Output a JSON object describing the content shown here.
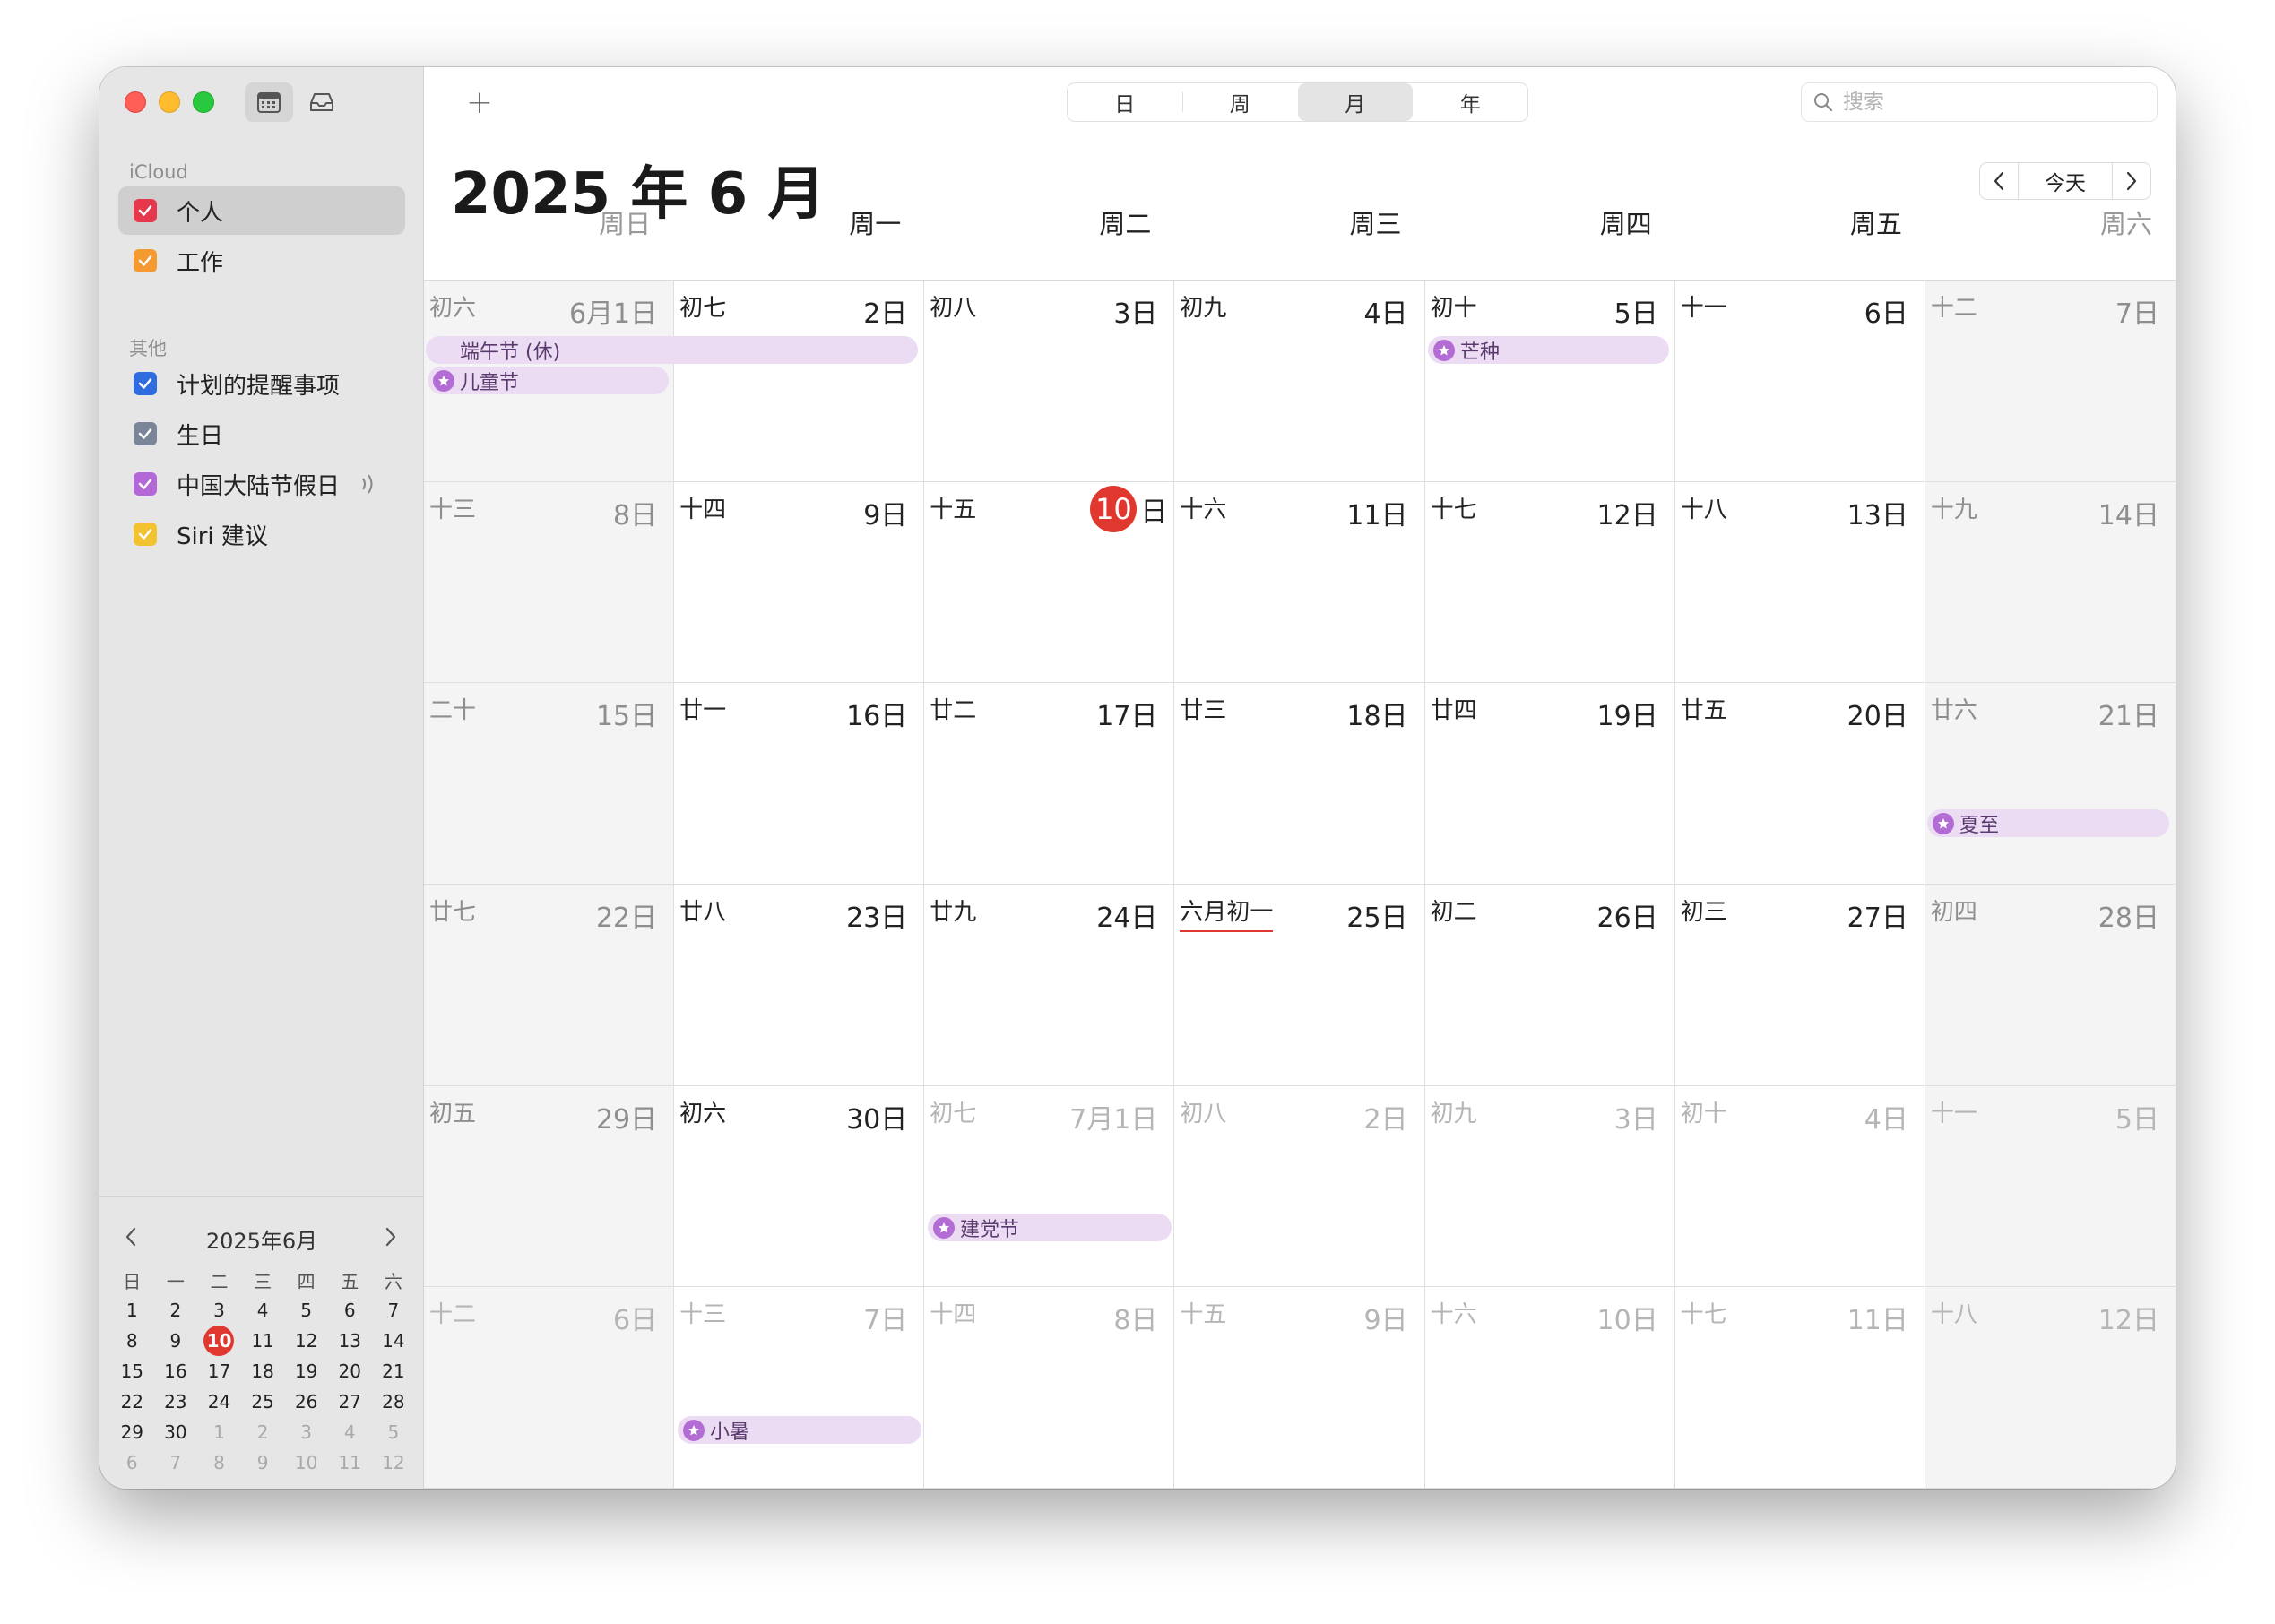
{
  "toolbar": {
    "views": [
      "日",
      "周",
      "月",
      "年"
    ],
    "active_view": "月",
    "search_placeholder": "搜索",
    "add_label": "+"
  },
  "sidebar": {
    "section_icloud": "iCloud",
    "icloud_items": [
      {
        "label": "个人",
        "color": "#e5384d",
        "selected": true
      },
      {
        "label": "工作",
        "color": "#f49a31",
        "selected": false
      }
    ],
    "section_other": "其他",
    "other_items": [
      {
        "label": "计划的提醒事项",
        "color": "#2f6ce0"
      },
      {
        "label": "生日",
        "color": "#7a8599"
      },
      {
        "label": "中国大陆节假日",
        "color": "#b467d6",
        "broadcast": true
      },
      {
        "label": "Siri 建议",
        "color": "#f3c230"
      }
    ]
  },
  "mini_calendar": {
    "title": "2025年6月",
    "weekdays": [
      "日",
      "一",
      "二",
      "三",
      "四",
      "五",
      "六"
    ],
    "rows": [
      [
        "1",
        "2",
        "3",
        "4",
        "5",
        "6",
        "7"
      ],
      [
        "8",
        "9",
        "10",
        "11",
        "12",
        "13",
        "14"
      ],
      [
        "15",
        "16",
        "17",
        "18",
        "19",
        "20",
        "21"
      ],
      [
        "22",
        "23",
        "24",
        "25",
        "26",
        "27",
        "28"
      ],
      [
        "29",
        "30",
        "1",
        "2",
        "3",
        "4",
        "5"
      ],
      [
        "6",
        "7",
        "8",
        "9",
        "10",
        "11",
        "12"
      ]
    ],
    "today": "10"
  },
  "header": {
    "month_title": "2025 年 6 月",
    "today_button": "今天"
  },
  "weekdays": [
    "周日",
    "周一",
    "周二",
    "周三",
    "周四",
    "周五",
    "周六"
  ],
  "weeks": [
    [
      {
        "lunar": "初六",
        "day": "6月1日"
      },
      {
        "lunar": "初七",
        "day": "2日"
      },
      {
        "lunar": "初八",
        "day": "3日"
      },
      {
        "lunar": "初九",
        "day": "4日"
      },
      {
        "lunar": "初十",
        "day": "5日"
      },
      {
        "lunar": "十一",
        "day": "6日"
      },
      {
        "lunar": "十二",
        "day": "7日"
      }
    ],
    [
      {
        "lunar": "十三",
        "day": "8日"
      },
      {
        "lunar": "十四",
        "day": "9日"
      },
      {
        "lunar": "十五",
        "day": "10",
        "day_suffix": "日"
      },
      {
        "lunar": "十六",
        "day": "11日"
      },
      {
        "lunar": "十七",
        "day": "12日"
      },
      {
        "lunar": "十八",
        "day": "13日"
      },
      {
        "lunar": "十九",
        "day": "14日"
      }
    ],
    [
      {
        "lunar": "二十",
        "day": "15日"
      },
      {
        "lunar": "廿一",
        "day": "16日"
      },
      {
        "lunar": "廿二",
        "day": "17日"
      },
      {
        "lunar": "廿三",
        "day": "18日"
      },
      {
        "lunar": "廿四",
        "day": "19日"
      },
      {
        "lunar": "廿五",
        "day": "20日"
      },
      {
        "lunar": "廿六",
        "day": "21日"
      }
    ],
    [
      {
        "lunar": "廿七",
        "day": "22日"
      },
      {
        "lunar": "廿八",
        "day": "23日"
      },
      {
        "lunar": "廿九",
        "day": "24日"
      },
      {
        "lunar": "六月初一",
        "day": "25日"
      },
      {
        "lunar": "初二",
        "day": "26日"
      },
      {
        "lunar": "初三",
        "day": "27日"
      },
      {
        "lunar": "初四",
        "day": "28日"
      }
    ],
    [
      {
        "lunar": "初五",
        "day": "29日"
      },
      {
        "lunar": "初六",
        "day": "30日"
      },
      {
        "lunar": "初七",
        "day": "7月1日"
      },
      {
        "lunar": "初八",
        "day": "2日"
      },
      {
        "lunar": "初九",
        "day": "3日"
      },
      {
        "lunar": "初十",
        "day": "4日"
      },
      {
        "lunar": "十一",
        "day": "5日"
      }
    ],
    [
      {
        "lunar": "十二",
        "day": "6日"
      },
      {
        "lunar": "十三",
        "day": "7日"
      },
      {
        "lunar": "十四",
        "day": "8日"
      },
      {
        "lunar": "十五",
        "day": "9日"
      },
      {
        "lunar": "十六",
        "day": "10日"
      },
      {
        "lunar": "十七",
        "day": "11日"
      },
      {
        "lunar": "十八",
        "day": "12日"
      }
    ]
  ],
  "events": {
    "dragon_boat": "端午节 (休)",
    "children_day": "儿童节",
    "grain_in_ear": "芒种",
    "summer_solstice": "夏至",
    "party_day": "建党节",
    "minor_heat": "小暑"
  },
  "colors": {
    "accent_red": "#e0382f",
    "event_bg": "#ecdcf3",
    "event_star": "#b36cd4"
  }
}
